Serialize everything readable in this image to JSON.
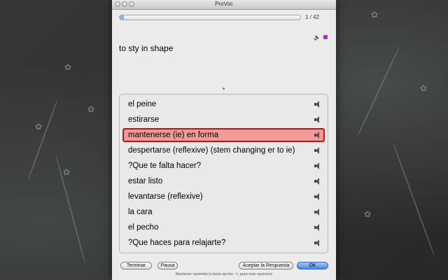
{
  "window": {
    "title": "ProVoc"
  },
  "progress": {
    "counter": "1 / 42",
    "fraction": 0.024
  },
  "icons": {
    "sound": "speaker-icon",
    "notes": "notes-icon"
  },
  "prompt": "to sty in shape",
  "answers": [
    {
      "label": "el peine",
      "selected": false
    },
    {
      "label": "estirarse",
      "selected": false
    },
    {
      "label": "mantenerse (ie) en forma",
      "selected": true
    },
    {
      "label": "despertarse (reflexive) (stem changing er to ie)",
      "selected": false
    },
    {
      "label": "?Que te falta hacer?",
      "selected": false
    },
    {
      "label": "estar listo",
      "selected": false
    },
    {
      "label": "levantarse (reflexive)",
      "selected": false
    },
    {
      "label": "la cara",
      "selected": false
    },
    {
      "label": "el pecho",
      "selected": false
    },
    {
      "label": "?Que haces para relajarte?",
      "selected": false
    }
  ],
  "buttons": {
    "terminate": "Terminar",
    "pause": "Pausa",
    "accept": "Aceptar la Respuesta",
    "ok": "OK"
  },
  "footer": "Mantener oprimida la tecla opción ⌥ para más opciones",
  "colors": {
    "selection_fill": "#f09a9a",
    "selection_border": "#c81010",
    "ok_button": "#4a86e0"
  }
}
